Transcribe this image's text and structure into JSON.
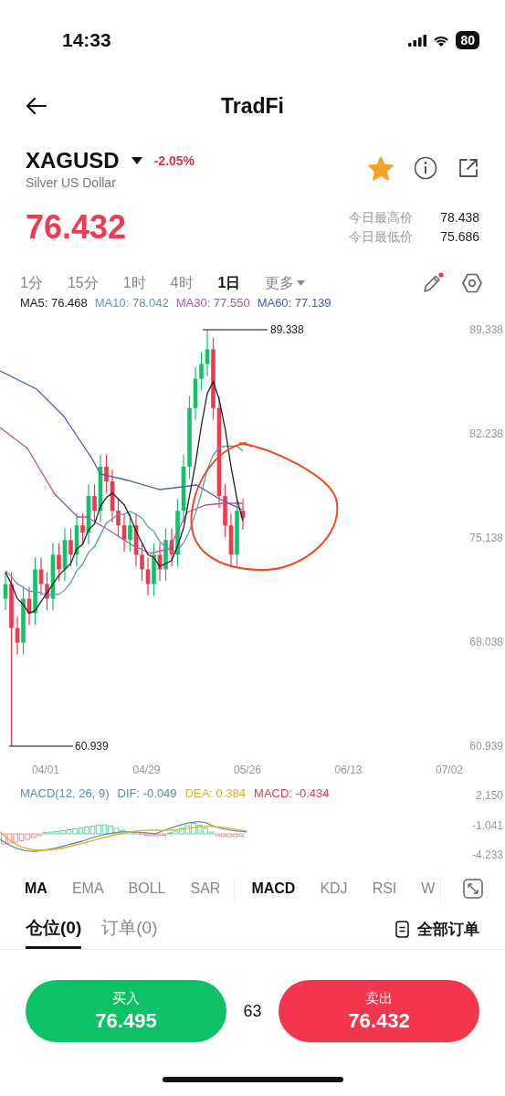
{
  "status_bar": {
    "time": "14:33",
    "battery": "80"
  },
  "header": {
    "title": "TradFi"
  },
  "instrument": {
    "symbol": "XAGUSD",
    "change": "-2.05%",
    "name": "Silver US Dollar",
    "favorite": true,
    "price": "76.432",
    "stats": [
      {
        "label": "今日最高价",
        "value": "78.438"
      },
      {
        "label": "今日最低价",
        "value": "75.686"
      }
    ]
  },
  "timeframes": [
    {
      "label": "1分",
      "selected": false
    },
    {
      "label": "15分",
      "selected": false
    },
    {
      "label": "1时",
      "selected": false
    },
    {
      "label": "4时",
      "selected": false
    },
    {
      "label": "1日",
      "selected": true
    }
  ],
  "more_menu": "更多",
  "ma_legend": [
    {
      "label": "MA5: 76.468",
      "color": "#222222"
    },
    {
      "label": "MA10: 78.042",
      "color": "#5b9bb0"
    },
    {
      "label": "MA30: 77.550",
      "color": "#b455a0"
    },
    {
      "label": "MA60: 77.139",
      "color": "#4a5bc4"
    }
  ],
  "chart": {
    "high_label": "89.338",
    "low_label": "60.939",
    "y_labels": [
      "89.338",
      "82.238",
      "75.138",
      "68.038",
      "60.939"
    ],
    "x_labels": [
      "04/01",
      "04/29",
      "05/26",
      "06/13",
      "07/02"
    ]
  },
  "macd": {
    "legend": [
      {
        "label": "MACD(12, 26, 9)",
        "color": "#5b8fa8"
      },
      {
        "label": "DIF: -0.049",
        "color": "#5b8fa8"
      },
      {
        "label": "DEA: 0.384",
        "color": "#e0b030"
      },
      {
        "label": "MACD: -0.434",
        "color": "#e0405a"
      }
    ],
    "y_labels": [
      "2.150",
      "-1.041",
      "-4.233"
    ]
  },
  "main_indicators": [
    {
      "label": "MA",
      "selected": true
    },
    {
      "label": "EMA",
      "selected": false
    },
    {
      "label": "BOLL",
      "selected": false
    },
    {
      "label": "SAR",
      "selected": false
    }
  ],
  "sub_indicators": [
    {
      "label": "MACD",
      "selected": true
    },
    {
      "label": "KDJ",
      "selected": false
    },
    {
      "label": "RSI",
      "selected": false
    },
    {
      "label": "W",
      "selected": false
    }
  ],
  "position_tabs": [
    {
      "label": "仓位(0)",
      "selected": true
    },
    {
      "label": "订单(0)",
      "selected": false
    }
  ],
  "all_orders": "全部订单",
  "trade": {
    "buy": {
      "label": "买入",
      "price": "76.495"
    },
    "spread": "63",
    "sell": {
      "label": "卖出",
      "price": "76.432"
    }
  }
}
